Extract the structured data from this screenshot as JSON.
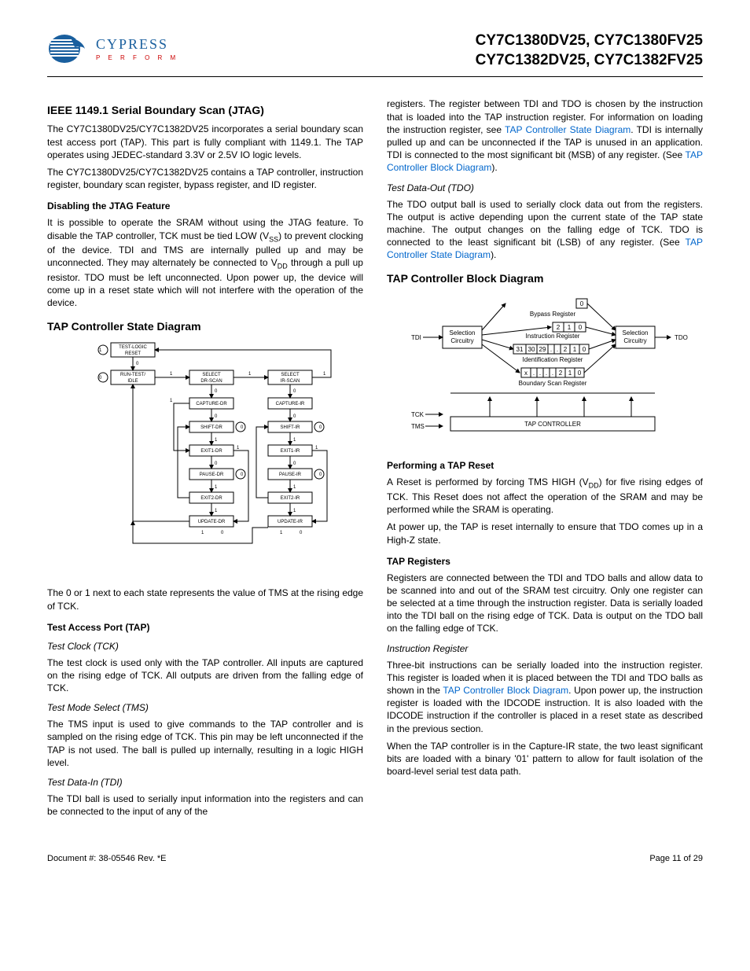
{
  "header": {
    "logo_name": "CYPRESS",
    "logo_tagline": "P E R F O R M",
    "parts_line1": "CY7C1380DV25, CY7C1380FV25",
    "parts_line2": "CY7C1382DV25, CY7C1382FV25"
  },
  "left": {
    "h_jtag": "IEEE 1149.1 Serial Boundary Scan (JTAG)",
    "p1": "The CY7C1380DV25/CY7C1382DV25 incorporates a serial boundary scan test access port (TAP). This part is fully compliant with 1149.1. The TAP operates using JEDEC-standard 3.3V or 2.5V IO logic levels.",
    "p2": "The CY7C1380DV25/CY7C1382DV25 contains a TAP controller, instruction register, boundary scan register, bypass register, and ID register.",
    "h_disable": "Disabling the JTAG Feature",
    "p3a": "It is possible to operate the SRAM without using the JTAG feature. To disable the TAP controller, TCK must be tied LOW (V",
    "p3b": ") to prevent clocking of the device. TDI and TMS are internally pulled up and may be unconnected. They may alternately be connected to V",
    "p3c": " through a pull up resistor. TDO must be left unconnected. Upon power up, the device will come up in a reset state which will not interfere with the operation of the device.",
    "h_state": "TAP Controller State Diagram",
    "p4": "The 0 or 1 next to each state represents the value of TMS at the rising edge of TCK.",
    "h_tap": "Test Access Port (TAP)",
    "h_tck": "Test Clock (TCK)",
    "p5": "The test clock is used only with the TAP controller. All inputs are captured on the rising edge of TCK. All outputs are driven from the falling edge of TCK.",
    "h_tms": "Test Mode Select (TMS)",
    "p6": "The TMS input is used to give commands to the TAP controller and is sampled on the rising edge of TCK. This pin may be left unconnected if the TAP is not used. The ball is pulled up internally, resulting in a logic HIGH level.",
    "h_tdi": "Test Data-In (TDI)",
    "p7": "The TDI ball is used to serially input information into the registers and can be connected to the input of any of the"
  },
  "right": {
    "p1a": "registers. The register between TDI and TDO is chosen by the instruction that is loaded into the TAP instruction register. For information on loading the instruction register, see ",
    "link1": "TAP Controller State Diagram",
    "p1b": ". TDI is internally pulled up and can be unconnected if the TAP is unused in an application. TDI is connected to the most significant bit (MSB) of any register. (See ",
    "link2": "TAP Controller Block Diagram",
    "p1c": ").",
    "h_tdo": "Test Data-Out (TDO)",
    "p2a": "The TDO output ball is used to serially clock data out from the registers. The output is active depending upon the current state of the TAP state machine. The output changes on the falling edge of TCK. TDO is connected to the least significant bit (LSB) of any register. (See ",
    "link3": "TAP Controller State Diagram",
    "p2b": ").",
    "h_block": "TAP Controller Block Diagram",
    "h_reset": "Performing a TAP Reset",
    "p3a": "A Reset is performed by forcing TMS HIGH (V",
    "p3b": ") for five rising edges of TCK. This Reset does not affect the operation of the SRAM and may be performed while the SRAM is operating.",
    "p4": "At power up, the TAP is reset internally to ensure that TDO comes up in a High-Z state.",
    "h_regs": "TAP Registers",
    "p5": "Registers are connected between the TDI and TDO balls and allow data to be scanned into and out of the SRAM test circuitry. Only one register can be selected at a time through the instruction register. Data is serially loaded into the TDI ball on the rising edge of TCK. Data is output on the TDO ball on the falling edge of TCK.",
    "h_ir": "Instruction Register",
    "p6a": "Three-bit instructions can be serially loaded into the instruction register. This register is loaded when it is placed between the TDI and TDO balls as shown in the ",
    "link4": "TAP Controller Block Diagram",
    "p6b": ". Upon power up, the instruction register is loaded with the IDCODE instruction. It is also loaded with the IDCODE instruction if the controller is placed in a reset state as described in the previous section.",
    "p7": "When the TAP controller is in the Capture-IR state, the two least significant bits are loaded with a binary '01' pattern to allow for fault isolation of the board-level serial test data path."
  },
  "state_diagram": {
    "states": [
      "TEST-LOGIC RESET",
      "RUN-TEST/ IDLE",
      "SELECT DR-SCAN",
      "SELECT IR-SCAN",
      "CAPTURE-DR",
      "CAPTURE-IR",
      "SHIFT-DR",
      "SHIFT-IR",
      "EXIT1-DR",
      "EXIT1-IR",
      "PAUSE-DR",
      "PAUSE-IR",
      "EXIT2-DR",
      "EXIT2-IR",
      "UPDATE-DR",
      "UPDATE-IR"
    ]
  },
  "block_diagram": {
    "signals": [
      "TDI",
      "TDO",
      "TCK",
      "TMS"
    ],
    "blocks": [
      "Bypass Register",
      "Instruction Register",
      "Identification Register",
      "Boundary Scan Register",
      "Selection Circuitry",
      "TAP CONTROLLER"
    ]
  },
  "footer": {
    "doc": "Document #: 38-05546 Rev. *E",
    "page": "Page 11 of 29"
  }
}
